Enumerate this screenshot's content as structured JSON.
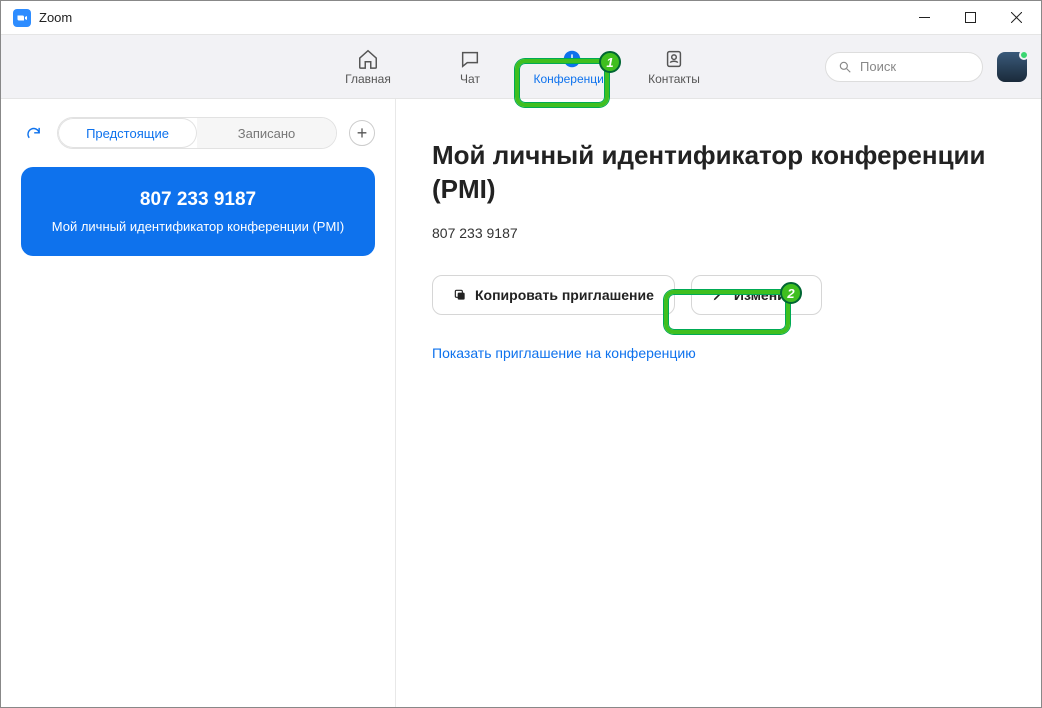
{
  "window": {
    "title": "Zoom"
  },
  "nav": {
    "items": [
      {
        "label": "Главная",
        "name": "nav-home"
      },
      {
        "label": "Чат",
        "name": "nav-chat"
      },
      {
        "label": "Конференции",
        "name": "nav-meetings"
      },
      {
        "label": "Контакты",
        "name": "nav-contacts"
      }
    ],
    "search_placeholder": "Поиск"
  },
  "sidebar": {
    "tabs": {
      "upcoming": "Предстоящие",
      "recorded": "Записано"
    },
    "card": {
      "id": "807 233 9187",
      "sub": "Мой личный идентификатор конференции (PMI)"
    }
  },
  "main": {
    "heading": "Мой личный идентификатор конференции (PMI)",
    "pmi": "807 233 9187",
    "copy_btn": "Копировать приглашение",
    "edit_btn": "Изменить",
    "show_link": "Показать приглашение на конференцию"
  },
  "annotations": {
    "1": "1",
    "2": "2"
  }
}
